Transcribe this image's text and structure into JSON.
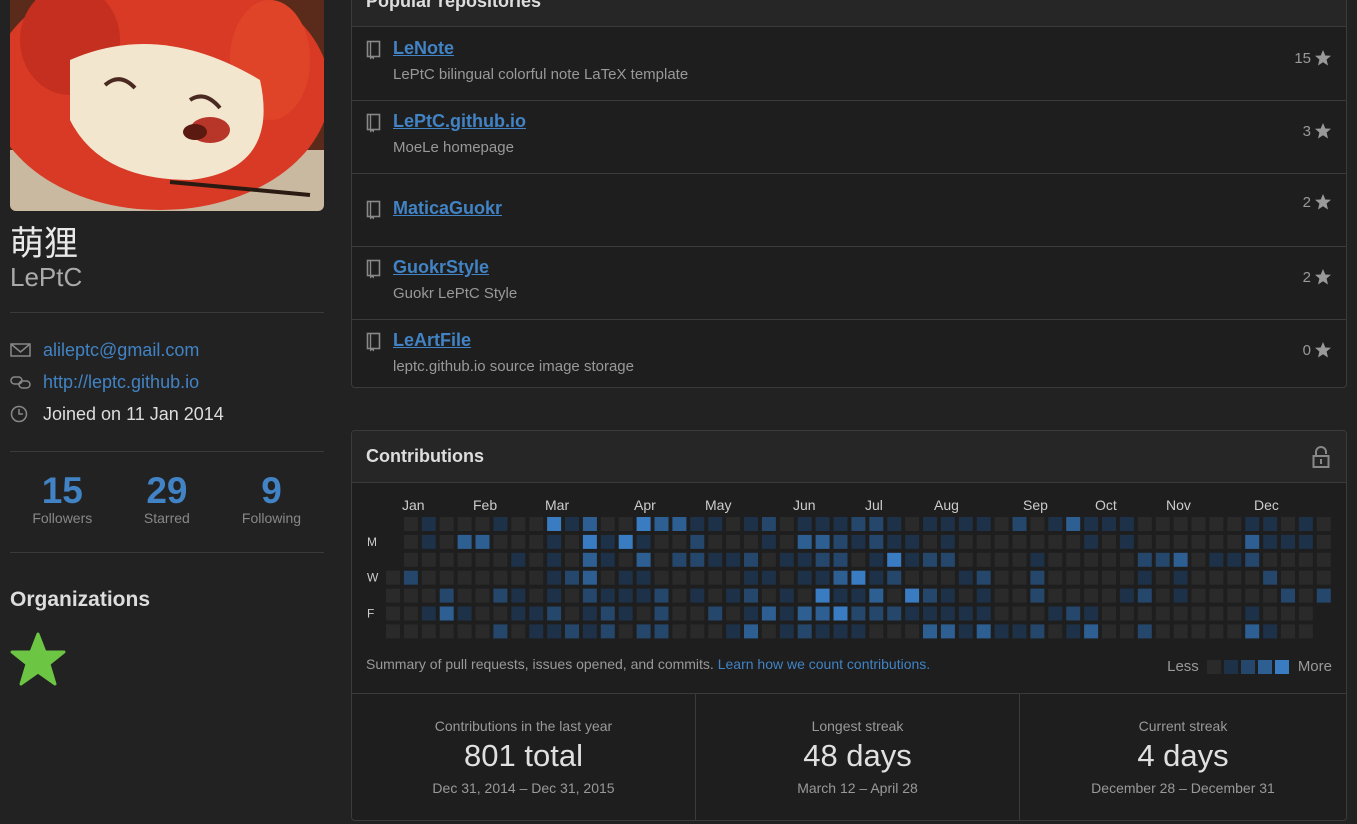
{
  "profile": {
    "fullname": "萌狸",
    "username": "LePtC",
    "email": "alileptc@gmail.com",
    "website": "http://leptc.github.io",
    "joined": "Joined on 11 Jan 2014"
  },
  "stats": [
    {
      "value": "15",
      "label": "Followers"
    },
    {
      "value": "29",
      "label": "Starred"
    },
    {
      "value": "9",
      "label": "Following"
    }
  ],
  "organizations": {
    "title": "Organizations",
    "items": [
      {
        "icon": "green-star-org-icon"
      }
    ]
  },
  "popular_repos": {
    "title": "Popular repositories",
    "items": [
      {
        "name": "LeNote",
        "description": "LePtC bilingual colorful note LaTeX template",
        "stars": "15"
      },
      {
        "name": "LePtC.github.io",
        "description": "MoeLe homepage",
        "stars": "3"
      },
      {
        "name": "MaticaGuokr",
        "description": "",
        "stars": "2"
      },
      {
        "name": "GuokrStyle",
        "description": "Guokr LePtC Style",
        "stars": "2"
      },
      {
        "name": "LeArtFile",
        "description": "leptc.github.io source image storage",
        "stars": "0"
      }
    ]
  },
  "contributions": {
    "title": "Contributions",
    "months": [
      "Jan",
      "Feb",
      "Mar",
      "Apr",
      "May",
      "Jun",
      "Jul",
      "Aug",
      "Sep",
      "Oct",
      "Nov",
      "Dec"
    ],
    "days": [
      "M",
      "W",
      "F"
    ],
    "summary": "Summary of pull requests, issues opened, and commits.",
    "learn_link": "Learn how we count contributions.",
    "legend_less": "Less",
    "legend_more": "More",
    "colors": [
      "#2a2a2a",
      "#1d3148",
      "#24476b",
      "#2d5f93",
      "#3a7cc2"
    ],
    "stats": [
      {
        "title": "Contributions in the last year",
        "value": "801 total",
        "range": "Dec 31, 2014 – Dec 31, 2015"
      },
      {
        "title": "Longest streak",
        "value": "48 days",
        "range": "March 12 – April 28"
      },
      {
        "title": "Current streak",
        "value": "4 days",
        "range": "December 28 – December 31"
      }
    ]
  }
}
